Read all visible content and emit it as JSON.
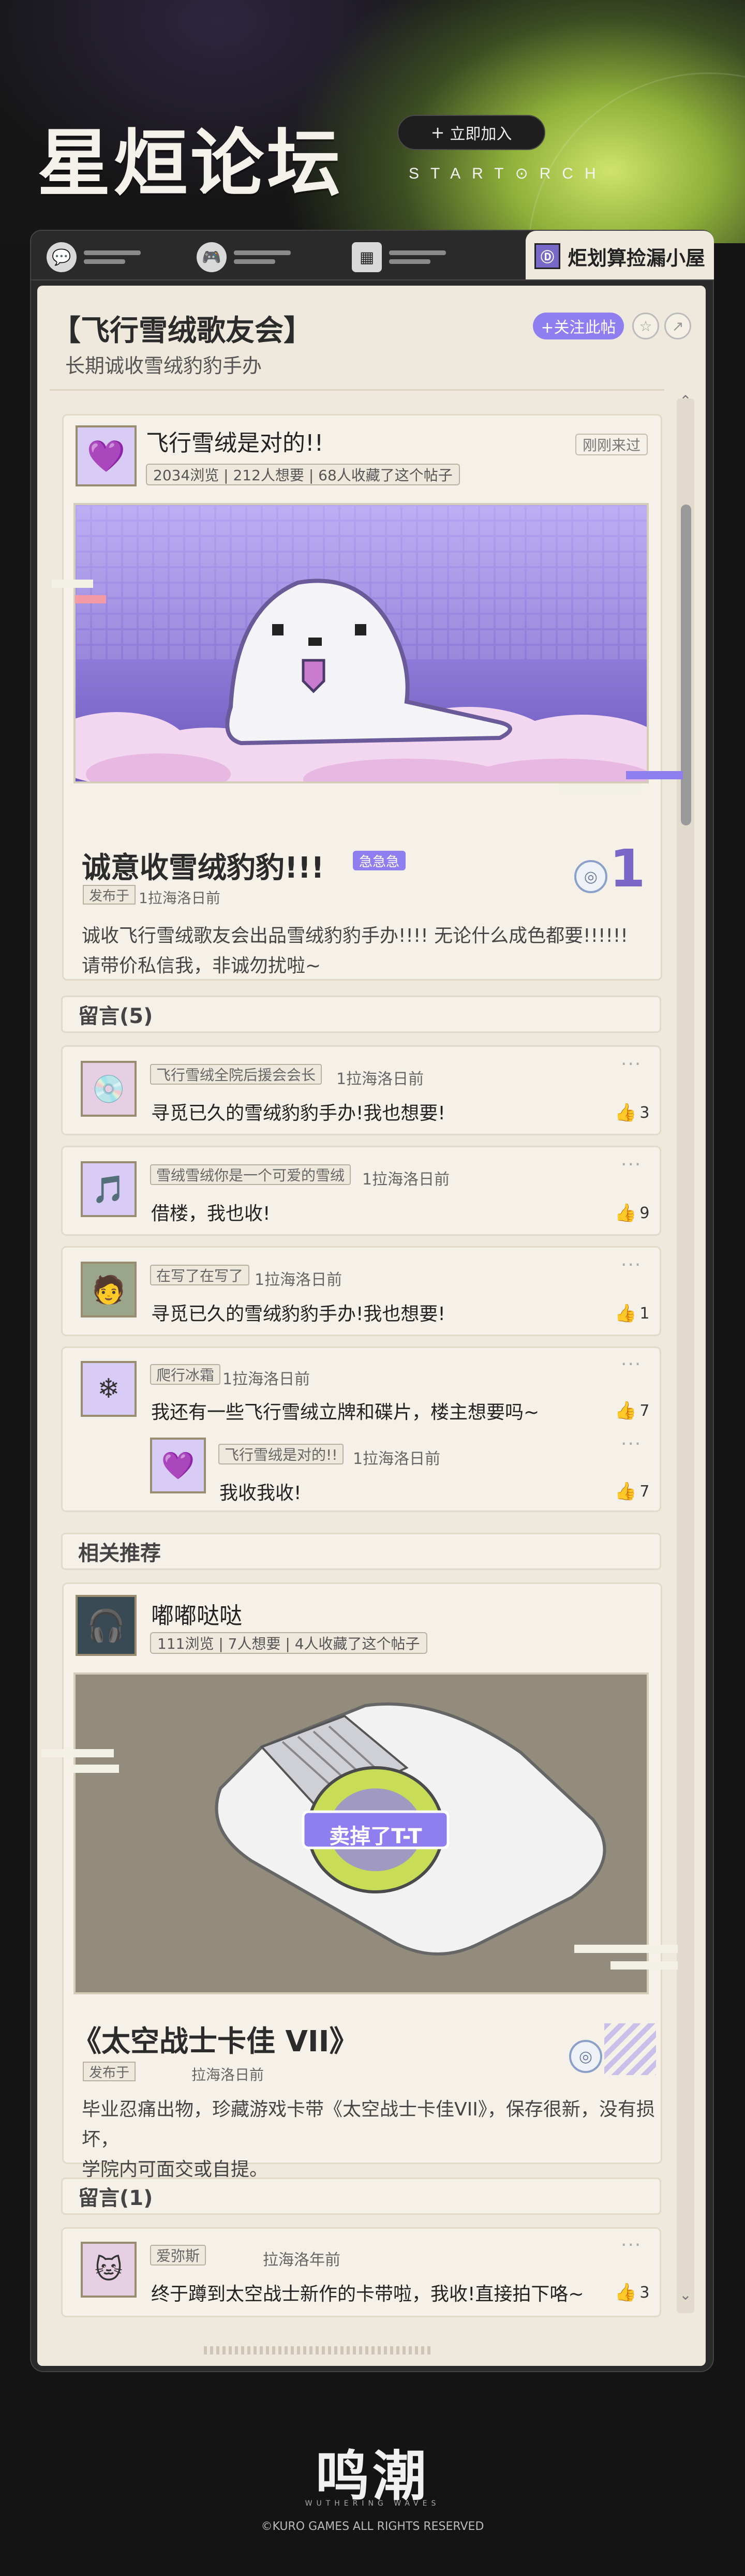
{
  "header": {
    "title": "星烜论坛",
    "join_button": "立即加入",
    "join_icon": "plus-icon",
    "brand": "START⊙RCH"
  },
  "tabs": {
    "active_badge": "Ⓓ",
    "active_label": "炬划算捡漏小屋"
  },
  "page": {
    "title": "【飞行雪绒歌友会】",
    "subtitle": "长期诚收雪绒豹豹手办",
    "follow_button": "+关注此帖"
  },
  "post1": {
    "author": "飞行雪绒是对的!!",
    "recent": "刚刚来过",
    "stats": "2034浏览 | 212人想要 | 68人收藏了这个帖子",
    "headline": "诚意收雪绒豹豹!!!",
    "urgent": "急急急",
    "pub_tag": "发布于",
    "pub_time": "1拉海洛日前",
    "rank": "1",
    "desc_line1": "诚收飞行雪绒歌友会出品雪绒豹豹手办!!!! 无论什么成色都要!!!!!!",
    "desc_line2": "请带价私信我，非诚勿扰啦~"
  },
  "comments1": {
    "header": "留言(5)",
    "items": [
      {
        "name": "飞行雪绒全院后援会会长",
        "time": "1拉海洛日前",
        "text": "寻觅已久的雪绒豹豹手办!我也想要!",
        "likes": "3"
      },
      {
        "name": "雪绒雪绒你是一个可爱的雪绒",
        "time": "1拉海洛日前",
        "text": "借楼，我也收!",
        "likes": "9"
      },
      {
        "name": "在写了在写了",
        "time": "1拉海洛日前",
        "text": "寻觅已久的雪绒豹豹手办!我也想要!",
        "likes": "1"
      },
      {
        "name": "爬行冰霜",
        "time": "1拉海洛日前",
        "text": "我还有一些飞行雪绒立牌和碟片，楼主想要吗~",
        "likes": "7"
      },
      {
        "name": "飞行雪绒是对的!!",
        "time": "1拉海洛日前",
        "text": "我收我收!",
        "likes": "7"
      }
    ]
  },
  "related": {
    "header": "相关推荐"
  },
  "post2": {
    "author": "嘟嘟哒哒",
    "stats": "111浏览 | 7人想要 | 4人收藏了这个帖子",
    "image_label": "卖掉了T-T",
    "headline": "《太空战士卡佳 VII》",
    "pub_tag": "发布于",
    "pub_time": "拉海洛日前",
    "desc_line1": "毕业忍痛出物，珍藏游戏卡带《太空战士卡佳VII》，保存很新，没有损坏，",
    "desc_line2": "学院内可面交或自提。"
  },
  "comments2": {
    "header": "留言(1)",
    "items": [
      {
        "name": "爱弥斯",
        "time": "拉海洛年前",
        "text": "终于蹲到太空战士新作的卡带啦，我收!直接拍下咯~",
        "likes": "3"
      }
    ]
  },
  "footer": {
    "logo": "鸣潮",
    "sub": "WUTHERING WAVES",
    "copyright": "©KURO GAMES ALL RIGHTS RESERVED"
  },
  "colors": {
    "accent": "#8e7ef0",
    "panel": "#efe9dd",
    "like": "#97c24a"
  }
}
